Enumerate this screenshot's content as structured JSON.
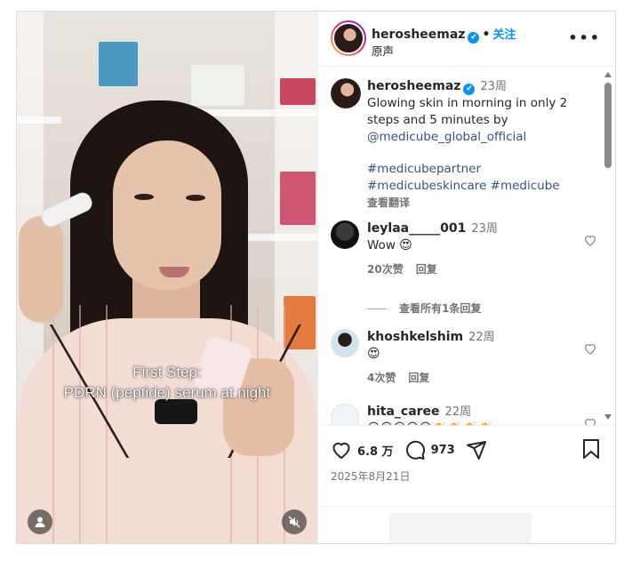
{
  "post": {
    "username": "herosheemaz",
    "verified_mark": "✔",
    "follow_label": "关注",
    "separator": "•",
    "audio_label": "原声",
    "more_label": "•••"
  },
  "media": {
    "caption_line1": "First Step:",
    "caption_line2": "PDRN (peptide) serum at night",
    "user_icon": "user-icon",
    "mute_icon": "muted-speaker-icon"
  },
  "caption": {
    "username": "herosheemaz",
    "time": "23周",
    "text_line1": "Glowing skin in morning in only 2",
    "text_line2": "steps and 5 minutes by",
    "mention": "@medicube_global_official",
    "hashtag1": "#medicubepartner",
    "hashtag2": "#medicubeskincare",
    "hashtag3": "#medicube",
    "translate_label": "查看翻译"
  },
  "comments": [
    {
      "username": "leylaa_____001",
      "time": "23周",
      "text": "Wow",
      "emoji": "😍",
      "likes": "20次赞",
      "reply": "回复"
    },
    {
      "username": "khoshkelshim",
      "time": "22周",
      "text": "",
      "emoji": "😍",
      "likes": "4次赞",
      "reply": "回复"
    },
    {
      "username": "hita_caree",
      "time": "22周",
      "text": "",
      "emoji": "😍😍😍😍😍👏👏👏👏",
      "likes": "",
      "reply": ""
    }
  ],
  "view_replies_label": "查看所有1条回复",
  "actions": {
    "like_count": "6.8 万",
    "comment_count": "973",
    "like_icon": "heart-icon",
    "comment_icon": "comment-icon",
    "share_icon": "send-icon",
    "save_icon": "bookmark-icon",
    "date": "2025年8月21日"
  },
  "colors": {
    "accent": "#0095f6",
    "link": "#385185",
    "muted": "#737373",
    "text": "#262626",
    "border": "#dbdbdb"
  }
}
